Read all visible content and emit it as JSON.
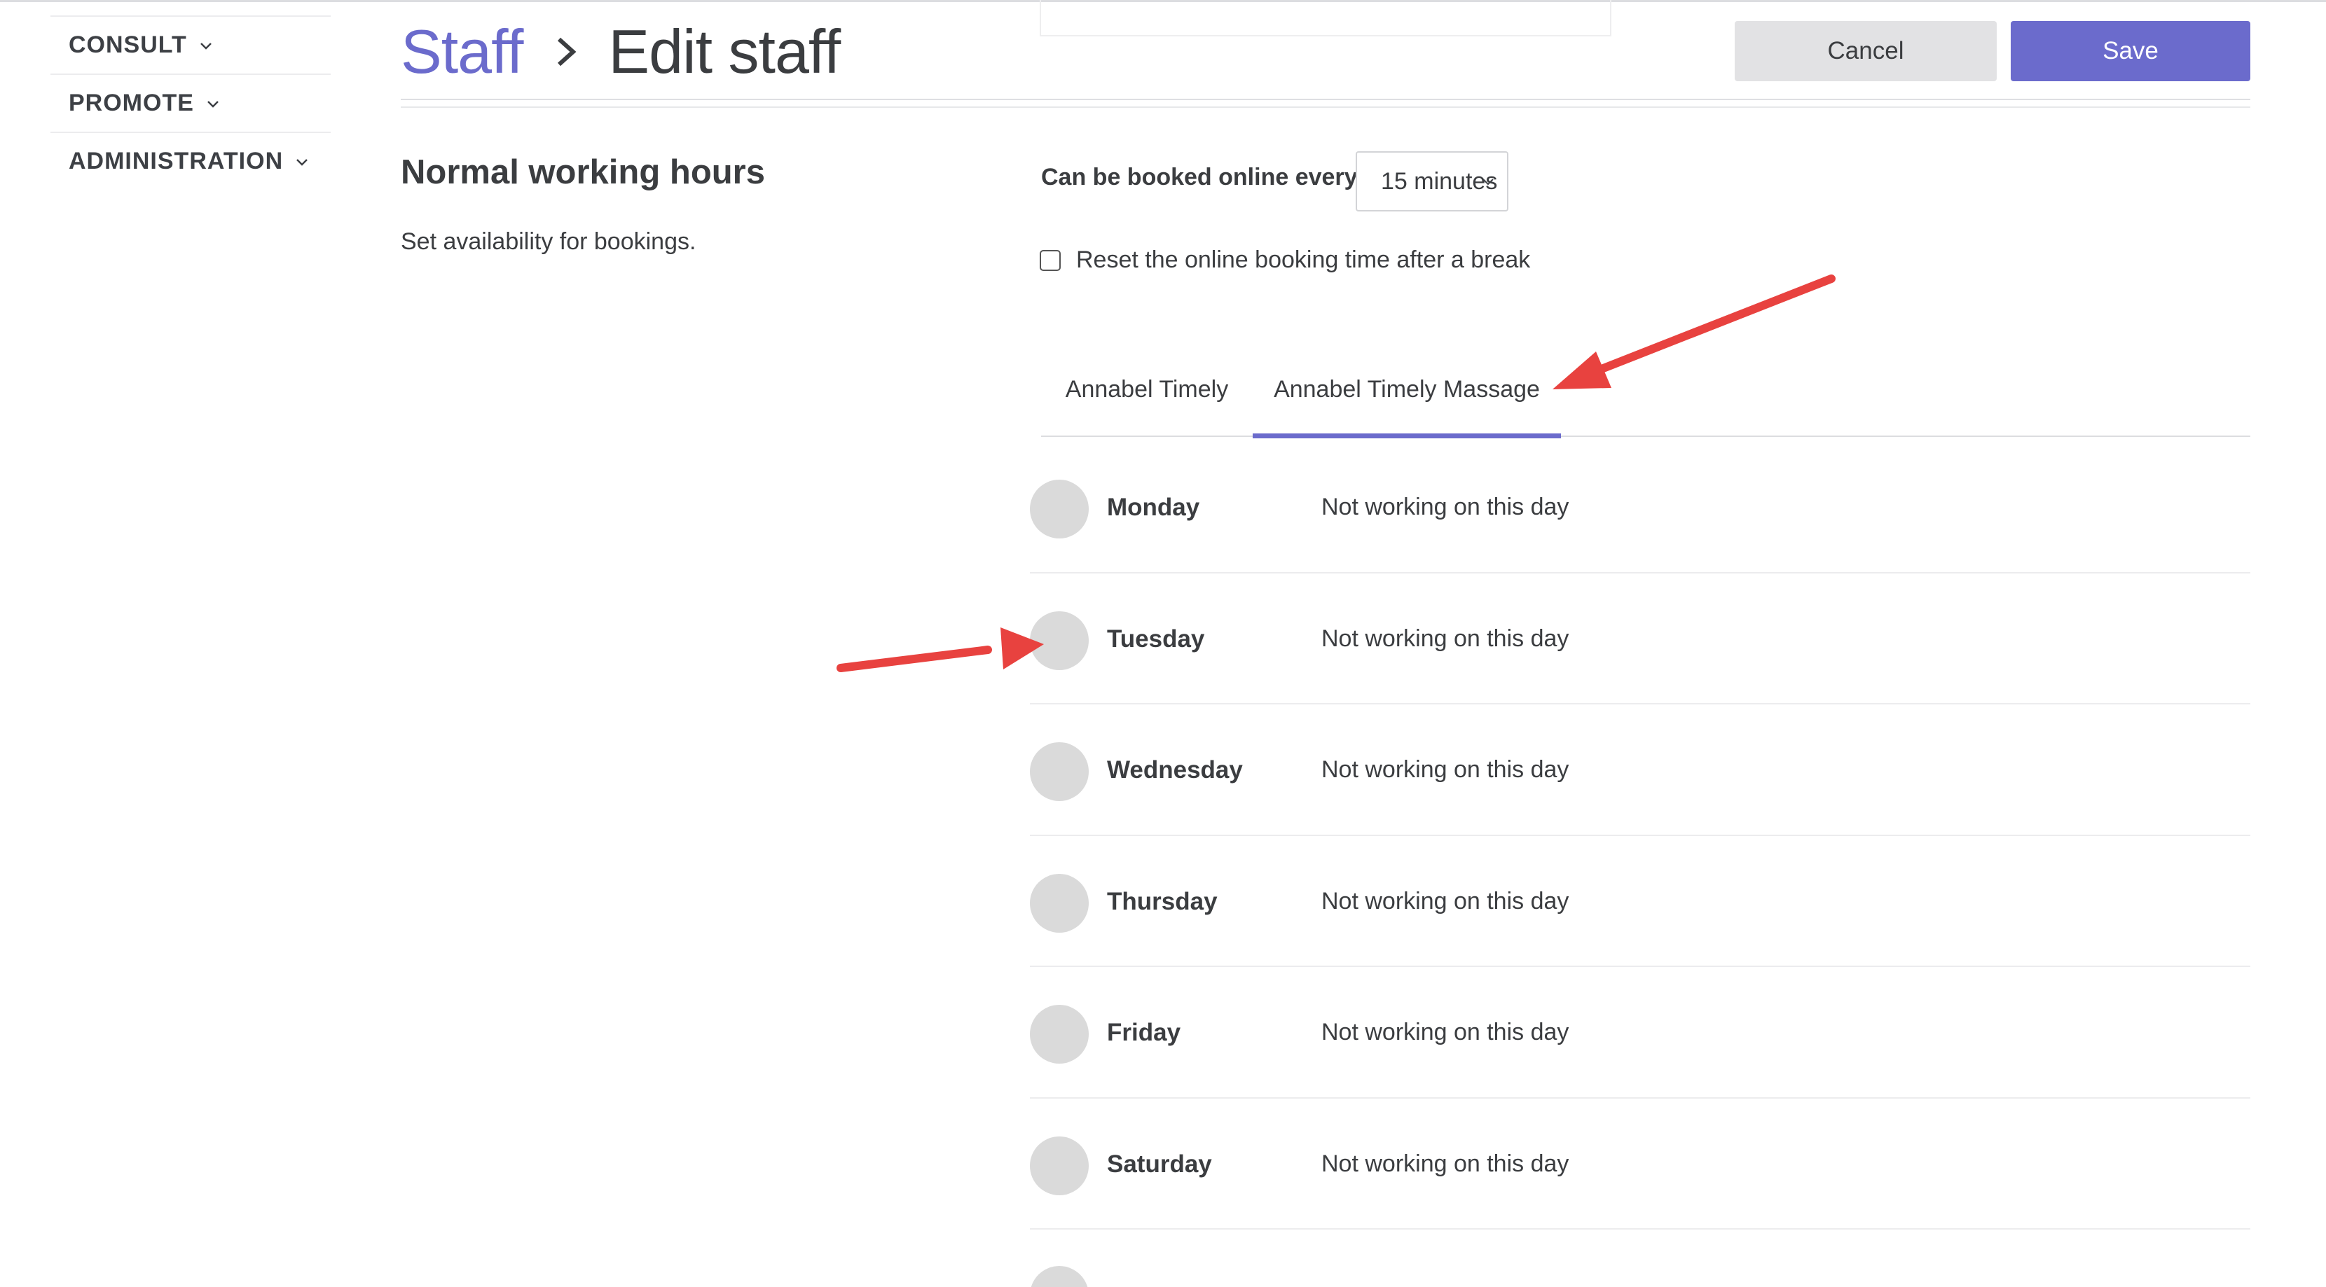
{
  "sidebar": {
    "items": [
      {
        "label": "CONSULT"
      },
      {
        "label": "PROMOTE"
      },
      {
        "label": "ADMINISTRATION"
      }
    ]
  },
  "header": {
    "breadcrumb_parent": "Staff",
    "breadcrumb_current": "Edit staff",
    "cancel_label": "Cancel",
    "save_label": "Save"
  },
  "section": {
    "title": "Normal working hours",
    "subtitle": "Set availability for bookings."
  },
  "booking": {
    "interval_label": "Can be booked online every",
    "interval_value": "15 minutes",
    "reset_label": "Reset the online booking time after a break",
    "reset_checked": false
  },
  "tabs": [
    {
      "label": "Annabel Timely",
      "active": false
    },
    {
      "label": "Annabel Timely Massage",
      "active": true
    }
  ],
  "days": [
    {
      "name": "Monday",
      "status": "Not working on this day"
    },
    {
      "name": "Tuesday",
      "status": "Not working on this day"
    },
    {
      "name": "Wednesday",
      "status": "Not working on this day"
    },
    {
      "name": "Thursday",
      "status": "Not working on this day"
    },
    {
      "name": "Friday",
      "status": "Not working on this day"
    },
    {
      "name": "Saturday",
      "status": "Not working on this day"
    }
  ],
  "colors": {
    "accent": "#6b6bcc",
    "annotation_arrow": "#e8423f",
    "toggle_off": "#dadada"
  }
}
